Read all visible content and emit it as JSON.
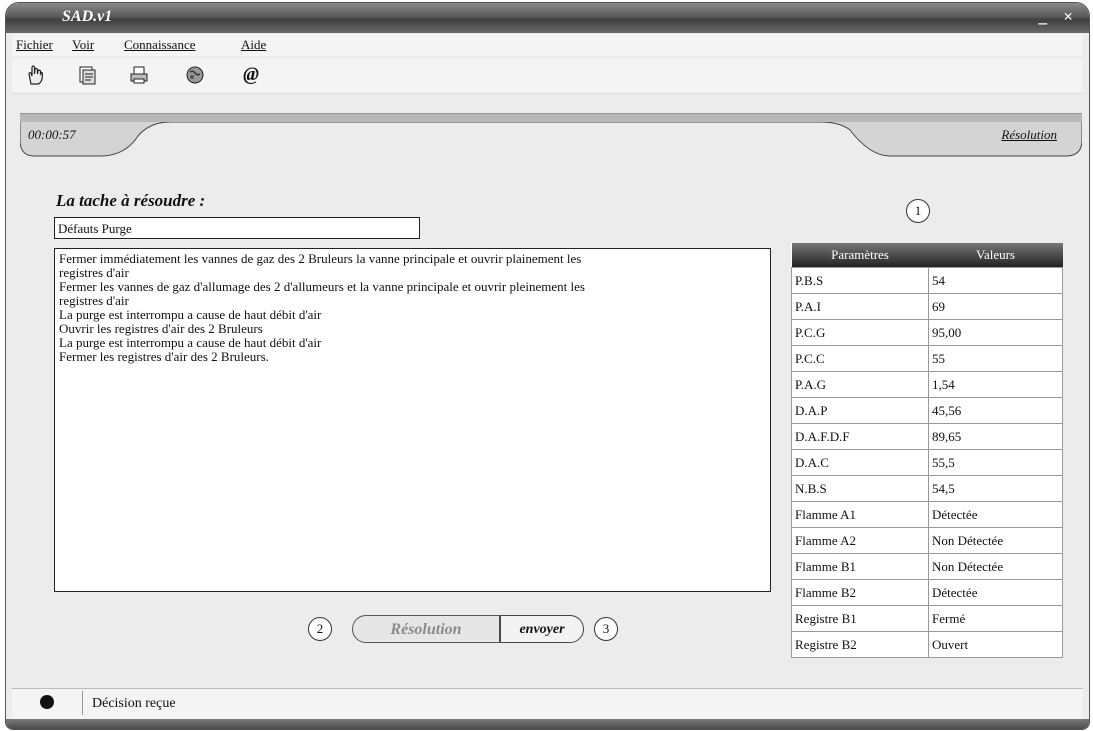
{
  "window": {
    "title": "SAD.v1",
    "minimize": "_",
    "close": "×"
  },
  "menu": {
    "items": [
      "Fichier",
      "Voir",
      "Connaissance",
      "Aide"
    ]
  },
  "toolbar": {
    "icons": [
      "hand-pointer-icon",
      "document-icon",
      "printer-icon",
      "globe-icon",
      "at-icon"
    ],
    "at_glyph": "@"
  },
  "header": {
    "timer": "00:00:57",
    "section": "Résolution"
  },
  "task": {
    "title": "La tache à résoudre :",
    "name": "Défauts Purge",
    "lines": [
      "Fermer immédiatement les vannes de gaz des 2 Bruleurs la vanne principale et ouvrir plainement les",
      "registres d'air",
      "Fermer les vannes de gaz d'allumage des 2 d'allumeurs et la vanne principale et ouvrir pleinement les",
      "registres d'air",
      "La purge est interrompu a cause de haut débit d'air",
      "Ouvrir les registres d'air des 2 Bruleurs",
      "La purge est interrompu a cause de haut débit d'air",
      "Fermer les registres d'air des 2 Bruleurs."
    ]
  },
  "callouts": {
    "one": "1",
    "two": "2",
    "three": "3"
  },
  "actions": {
    "resolution": "Résolution",
    "send": "envoyer"
  },
  "params": {
    "headers": [
      "Paramètres",
      "Valeurs"
    ],
    "rows": [
      [
        "P.B.S",
        "54"
      ],
      [
        "P.A.I",
        "69"
      ],
      [
        "P.C.G",
        "95,00"
      ],
      [
        "P.C.C",
        "55"
      ],
      [
        "P.A.G",
        "1,54"
      ],
      [
        "D.A.P",
        "45,56"
      ],
      [
        "D.A.F.D.F",
        "89,65"
      ],
      [
        "D.A.C",
        "55,5"
      ],
      [
        "N.B.S",
        "54,5"
      ],
      [
        "Flamme A1",
        "Détectée"
      ],
      [
        "Flamme A2",
        "Non Détectée"
      ],
      [
        "Flamme B1",
        "Non Détectée"
      ],
      [
        "Flamme B2",
        "Détectée"
      ],
      [
        "Registre B1",
        "Fermé"
      ],
      [
        "Registre B2",
        "Ouvert"
      ]
    ]
  },
  "status": {
    "text": "Décision reçue"
  }
}
